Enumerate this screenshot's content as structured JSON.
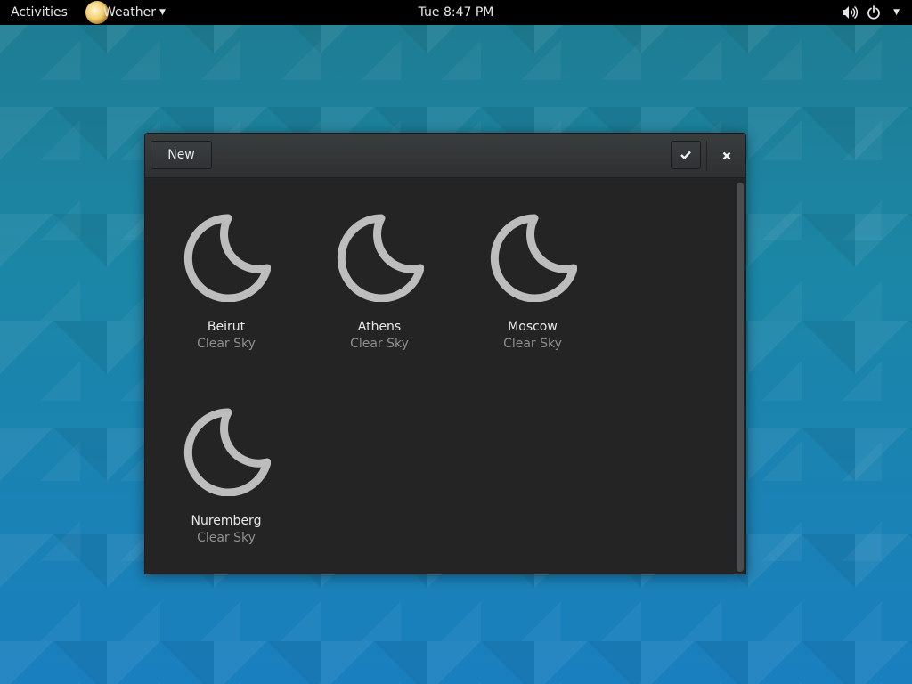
{
  "topbar": {
    "activities": "Activities",
    "app_name": "Weather",
    "clock": "Tue  8:47 PM",
    "icons": [
      "weather-app-icon",
      "volume-icon",
      "power-icon",
      "chevron-down-icon"
    ]
  },
  "window": {
    "new_button": "New",
    "done_icon": "check-icon",
    "close_icon": "close-icon"
  },
  "locations": [
    {
      "city": "Beirut",
      "condition": "Clear Sky",
      "icon": "moon-icon"
    },
    {
      "city": "Athens",
      "condition": "Clear Sky",
      "icon": "moon-icon"
    },
    {
      "city": "Moscow",
      "condition": "Clear Sky",
      "icon": "moon-icon"
    },
    {
      "city": "Nuremberg",
      "condition": "Clear Sky",
      "icon": "moon-icon"
    }
  ],
  "colors": {
    "topbar_bg": "#000000",
    "window_bg": "#262626",
    "icon_gray": "#bdbdbd",
    "desktop_teal": "#1b86a6"
  }
}
